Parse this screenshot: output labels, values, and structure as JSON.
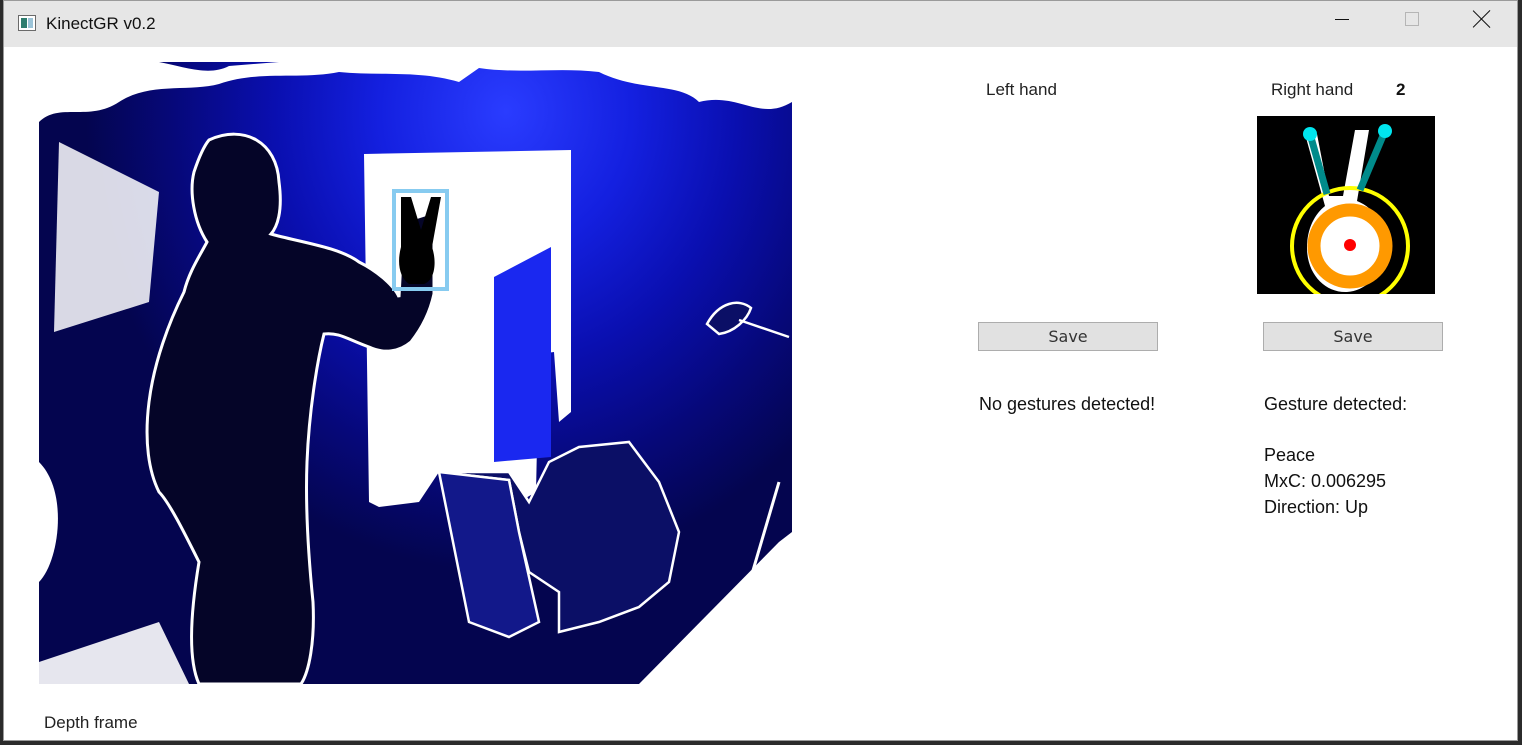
{
  "window": {
    "title": "KinectGR v0.2"
  },
  "depth_frame": {
    "label": "Depth frame"
  },
  "left_hand": {
    "label": "Left hand",
    "save_label": "Save",
    "status": "No gestures detected!"
  },
  "right_hand": {
    "label": "Right hand",
    "finger_count": "2",
    "save_label": "Save",
    "status": "Gesture detected:",
    "gesture_name": "Peace",
    "mxc": "MxC: 0.006295",
    "direction": "Direction: Up"
  },
  "icons": {
    "app": "app-icon",
    "minimize": "minimize-icon",
    "maximize": "maximize-icon",
    "close": "close-icon"
  },
  "colors": {
    "titlebar": "#e6e6e6",
    "depth_blue": "#1420e0",
    "depth_dark": "#04054f",
    "hand_box": "#87cbf0",
    "fingertip": "#00e5ee",
    "finger_line": "#008b8b",
    "palm_ring": "#ffff00",
    "palm_orange": "#ff9900",
    "center_dot": "#ff0000",
    "button_bg": "#e1e1e1"
  }
}
